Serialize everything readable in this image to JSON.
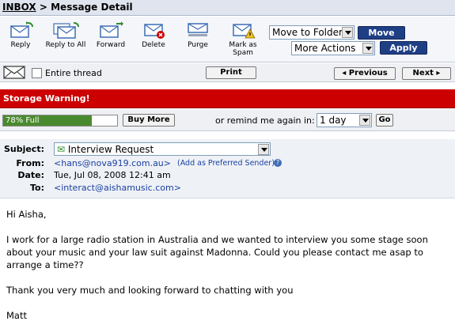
{
  "breadcrumb": {
    "inbox": "INBOX",
    "separator": " > ",
    "current": "Message Detail"
  },
  "toolbar": {
    "buttons": [
      {
        "label": "Reply",
        "icon": "reply-icon"
      },
      {
        "label": "Reply to All",
        "icon": "reply-all-icon"
      },
      {
        "label": "Forward",
        "icon": "forward-icon"
      },
      {
        "label": "Delete",
        "icon": "delete-icon"
      },
      {
        "label": "Purge",
        "icon": "purge-icon"
      },
      {
        "label": "Mark as Spam",
        "icon": "spam-icon"
      }
    ],
    "move_select": "Move to Folder",
    "move_button": "Move",
    "actions_select": "More Actions",
    "apply_button": "Apply"
  },
  "actionbar": {
    "entire_thread": "Entire thread",
    "print": "Print",
    "previous": "Previous",
    "next": "Next"
  },
  "storage": {
    "warning": "Storage Warning!",
    "usage_text": "78% Full",
    "usage_fraction": 0.78,
    "buy_more": "Buy More",
    "remind_label": "or remind me again in:",
    "remind_value": "1 day",
    "go": "Go"
  },
  "message": {
    "subject_label": "Subject:",
    "subject": "Interview Request",
    "from_label": "From:",
    "from": "<hans@nova919.com.au>",
    "add_sender": "(Add as Preferred Sender)",
    "date_label": "Date:",
    "date": "Tue, Jul 08, 2008 12:41 am",
    "to_label": "To:",
    "to": "<interact@aishamusic.com>",
    "body": [
      "Hi Aisha,",
      "I work for a large radio station in Australia and we wanted to interview you some stage soon about your music and your law suit against Madonna. Could you please contact me asap to arrange a time??",
      "Thank you very much and looking forward to chatting with you",
      "Matt"
    ]
  },
  "colors": {
    "warning_red": "#cc0000",
    "button_blue": "#1f3f85",
    "progress_green": "#4a8a2e",
    "link_blue": "#1a3fa0"
  }
}
